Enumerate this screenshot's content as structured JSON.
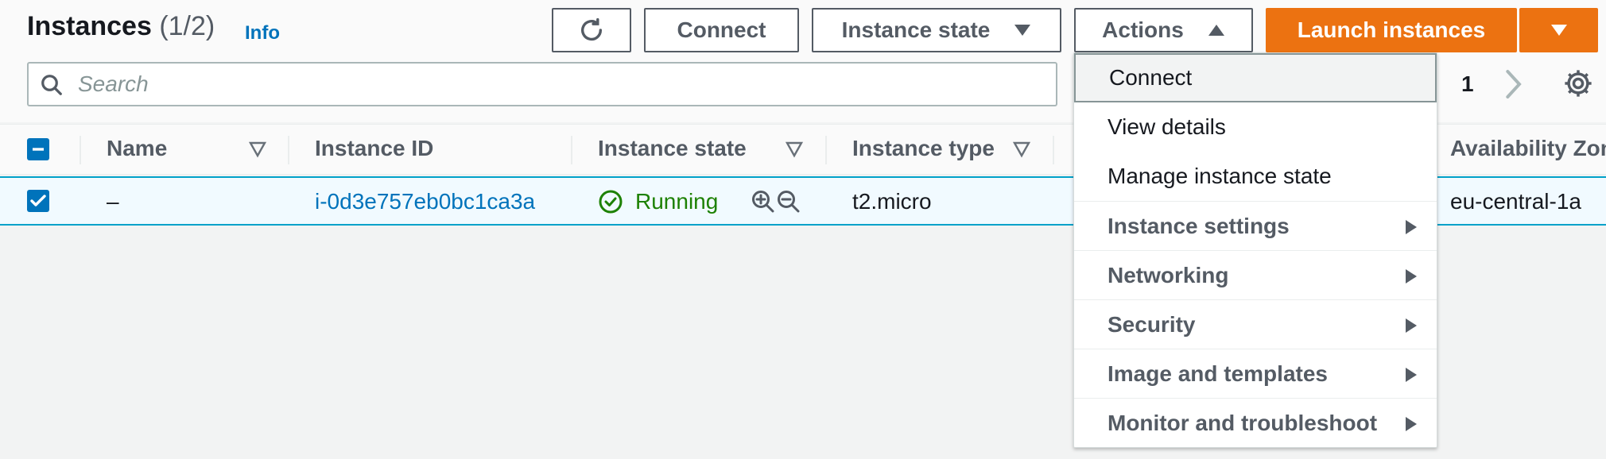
{
  "header": {
    "title": "Instances",
    "count": "(1/2)",
    "info": "Info"
  },
  "toolbar": {
    "connect": "Connect",
    "instance_state": "Instance state",
    "actions": "Actions",
    "launch": "Launch instances"
  },
  "search": {
    "placeholder": "Search",
    "value": ""
  },
  "pagination": {
    "page": "1"
  },
  "table": {
    "columns": [
      "Name",
      "Instance ID",
      "Instance state",
      "Instance type",
      "Availability Zone"
    ],
    "rows": [
      {
        "name": "–",
        "instance_id": "i-0d3e757eb0bc1ca3a",
        "state": "Running",
        "type": "t2.micro",
        "zone": "eu-central-1a"
      }
    ]
  },
  "actions_menu": {
    "items": [
      {
        "label": "Connect"
      },
      {
        "label": "View details"
      },
      {
        "label": "Manage instance state"
      },
      {
        "label": "Instance settings"
      },
      {
        "label": "Networking"
      },
      {
        "label": "Security"
      },
      {
        "label": "Image and templates"
      },
      {
        "label": "Monitor and troubleshoot"
      }
    ]
  },
  "colors": {
    "primary": "#ec7211",
    "link": "#0073bb",
    "running": "#1d8102",
    "selected_row": "#f1faff"
  },
  "icons": [
    "refresh-icon",
    "caret-down-icon",
    "caret-up-icon",
    "search-icon",
    "chevron-right-icon",
    "gear-icon",
    "sort-icon",
    "check-circle-icon",
    "zoom-in-icon",
    "zoom-out-icon",
    "submenu-caret-icon"
  ]
}
